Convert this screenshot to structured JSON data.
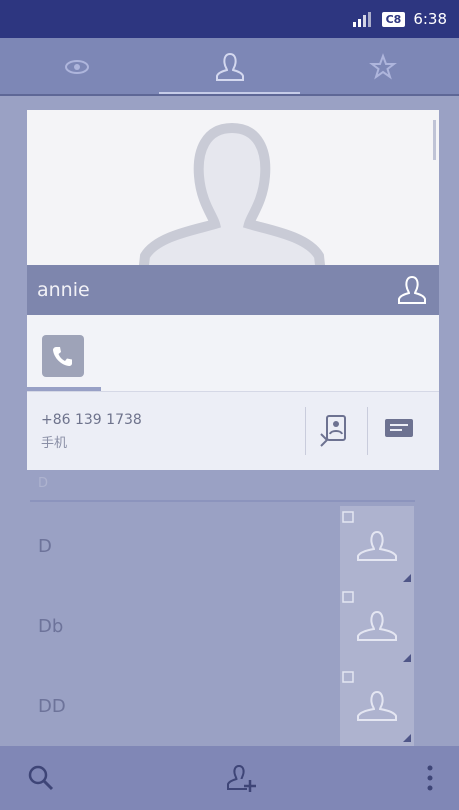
{
  "status": {
    "time": "6:38",
    "battery_label": "C8",
    "icons": [
      "signal-icon",
      "battery-icon"
    ]
  },
  "tabs": [
    {
      "icon": "recent-calls-icon",
      "active": false
    },
    {
      "icon": "contacts-icon",
      "active": true
    },
    {
      "icon": "favorites-star-icon",
      "active": false
    }
  ],
  "contact": {
    "name": "annie",
    "phone": {
      "number": "+86 139 1738",
      "label": "手机"
    }
  },
  "list": {
    "header": "D",
    "items": [
      {
        "name": "D"
      },
      {
        "name": "Db"
      },
      {
        "name": "DD"
      }
    ]
  },
  "bottom_actions": [
    "search-icon",
    "add-contact-icon",
    "overflow-menu-icon"
  ],
  "colors": {
    "statusbar": "#2d3680",
    "tabbar": "#7d87b6",
    "background": "#9aa1c4",
    "namebar": "#7e86ad",
    "bottombar": "#8087b6"
  }
}
